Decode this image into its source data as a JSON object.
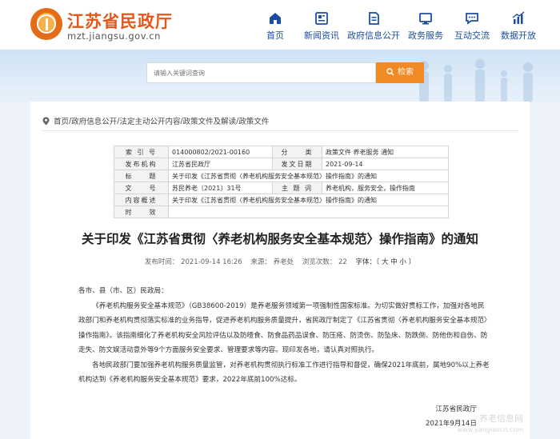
{
  "header": {
    "site_title": "江苏省民政厅",
    "site_domain": "mzt.jiangsu.gov.cn",
    "nav": [
      {
        "label": "首页",
        "icon": "home-icon"
      },
      {
        "label": "新闻资讯",
        "icon": "news-icon"
      },
      {
        "label": "政府信息公开",
        "icon": "document-icon"
      },
      {
        "label": "政务服务",
        "icon": "monitor-icon"
      },
      {
        "label": "互动交流",
        "icon": "chat-icon"
      },
      {
        "label": "数据开放",
        "icon": "chart-icon"
      }
    ]
  },
  "search": {
    "placeholder": "请输入关键词查询",
    "button_label": "检索"
  },
  "breadcrumb": {
    "items": [
      "首页",
      "政府信息公开",
      "法定主动公开内容",
      "政策文件及解读",
      "政策文件"
    ],
    "separator": " / "
  },
  "meta": {
    "index_label": "索 引 号",
    "index_value": "014000802/2021-00160",
    "category_label": "分　　类",
    "category_value": "政策文件 养老服务 通知",
    "publisher_label": "发布机构",
    "publisher_value": "江苏省民政厅",
    "date_label": "发文日期",
    "date_value": "2021-09-14",
    "title_label": "标　　题",
    "title_value": "关于印发《江苏省贯彻〈养老机构服务安全基本规范〉操作指南》的通知",
    "docno_label": "文　　号",
    "docno_value": "苏民养老〔2021〕31号",
    "keywords_label": "主 题 词",
    "keywords_value": "养老机构，服务安全，操作指南",
    "summary_label": "内容概述",
    "summary_value": "关于印发《江苏省贯彻〈养老机构服务安全基本规范〉操作指南》的通知",
    "validity_label": "时　　效",
    "validity_value": ""
  },
  "article": {
    "title": "关于印发《江苏省贯彻〈养老机构服务安全基本规范〉操作指南》的通知",
    "publish_time": "发布时间： 2021-09-14 16:26",
    "source": "来源： 养老处",
    "views": "浏览次数： 22",
    "font_label": "字体：",
    "font_size_options": "〔 大 中 小 〕",
    "salutation": "各市、县（市、区）民政局：",
    "paragraph1": "《养老机构服务安全基本规范》（GB38600-2019）是养老服务领域第一项强制性国家标准。为切实做好贯标工作，加强对各地民政部门和养老机构贯彻落实标准的业务指导，促进养老机构服务质量提升，省民政厅制定了《江苏省贯彻〈养老机构服务安全基本规范〉操作指南》。该指南细化了养老机构安全风险评估以及防噎食、防食品药品误食、防压疮、防烫伤、防坠床、防跌倒、防他伤和自伤、防走失、防文娱活动意外等9个方面服务安全要求、管理要求等内容。现印发各地，请认真对照执行。",
    "paragraph2": "各地民政部门要加强养老机构服务质量监管，对养老机构贯彻执行标准工作进行指导和督促，确保2021年底前，属地90%以上养老机构达到《养老机构服务安全基本规范》要求，2022年底前100%达标。",
    "signature_org": "江苏省民政厅",
    "signature_date": "2021年9月14日"
  },
  "watermark": {
    "line1": "养老信息网",
    "line2": "www.yanglaocn.com"
  },
  "colors": {
    "brand_orange": "#e3571b",
    "nav_blue": "#1b4ea0",
    "search_button": "#f08a24"
  }
}
